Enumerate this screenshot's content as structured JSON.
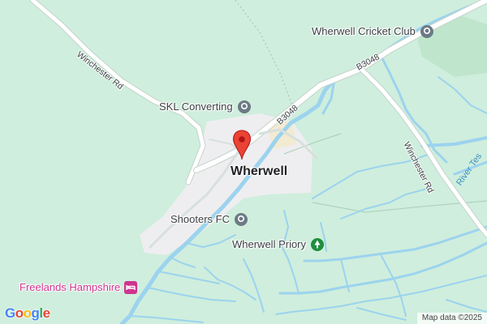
{
  "town": {
    "name": "Wherwell"
  },
  "pois": {
    "cricket_club": {
      "label": "Wherwell Cricket Club",
      "icon": "place-pin-icon"
    },
    "skl": {
      "label": "SKL Converting",
      "icon": "place-pin-icon"
    },
    "shooters": {
      "label": "Shooters FC",
      "icon": "place-pin-icon"
    },
    "priory": {
      "label": "Wherwell Priory",
      "icon": "park-icon"
    },
    "freelands": {
      "label": "Freelands Hampshire",
      "icon": "hotel-icon"
    }
  },
  "roads": {
    "winchester_rd_west": "Winchester Rd",
    "winchester_rd_east": "Winchester Rd",
    "b3048_north": "B3048",
    "b3048_center": "B3048"
  },
  "rivers": {
    "test": "River Tes"
  },
  "branding": {
    "logo": "Google",
    "attribution": "Map data ©2025"
  },
  "colors": {
    "land": "#cfeedd",
    "meadow": "#bfe6cc",
    "water": "#9cd3ee",
    "road": "#ffffff",
    "road_outline": "#c5d3cc",
    "urban": "#eeeef0",
    "marker": "#ea4335",
    "poi_icon": "#6c7a85",
    "park_icon": "#1e8e3e",
    "hotel_label": "#d0348f"
  }
}
